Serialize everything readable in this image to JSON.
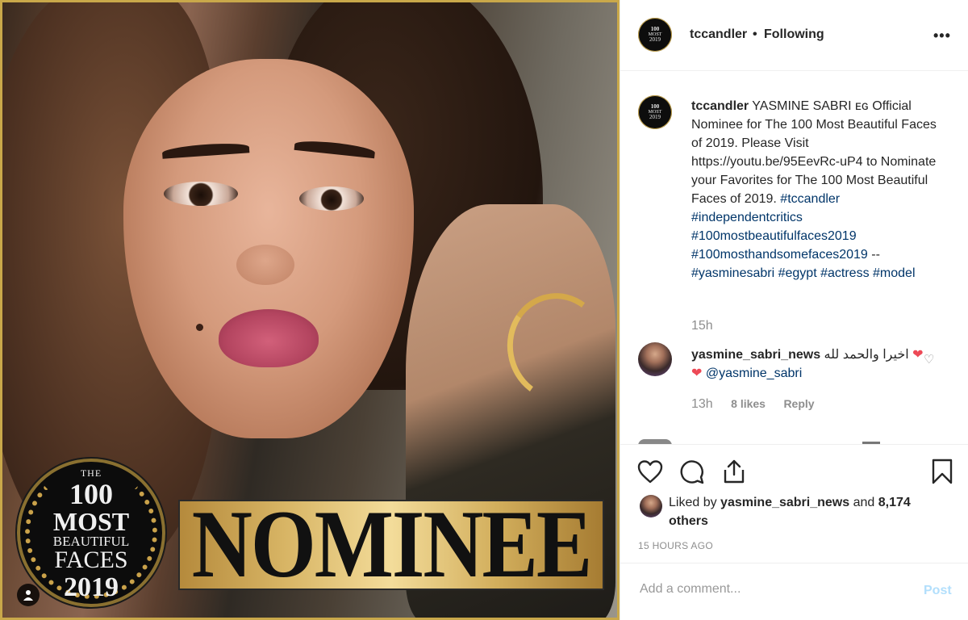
{
  "media": {
    "badge": {
      "line1": "THE",
      "line2": "100",
      "line3": "MOST",
      "line4": "BEAUTIFUL",
      "line5": "FACES",
      "line6": "2019"
    },
    "banner": "NOMINEE",
    "accent": "#c9a84a"
  },
  "header": {
    "username": "tccandler",
    "separator": "•",
    "follow_status": "Following",
    "more": "•••"
  },
  "avatar_badge": {
    "line1": "100",
    "line2": "MOST",
    "line3": "2019"
  },
  "caption": {
    "username": "tccandler",
    "text": "YASMINE SABRI ᴇɢ Official Nominee for The 100 Most Beautiful Faces of 2019. Please Visit https://youtu.be/95EevRc-uP4 to Nominate your Favorites for The 100 Most Beautiful Faces of 2019.",
    "hashtags": [
      "#tccandler",
      "#independentcritics",
      "#100mostbeautifulfaces2019",
      "#100mosthandsomefaces2019"
    ],
    "dashes": "--",
    "hashtags2": [
      "#yasminesabri",
      "#egypt",
      "#actress",
      "#model"
    ],
    "time": "15h"
  },
  "comment": {
    "username": "yasmine_sabri_news",
    "text_ar": "اخيرا والحمد لله",
    "hearts": "❤❤",
    "mention": "@yasmine_sabri",
    "time": "13h",
    "likes": "8 likes",
    "reply": "Reply"
  },
  "actions": {
    "liked_prefix": "Liked by",
    "liked_user": "yasmine_sabri_news",
    "liked_and": "and",
    "liked_count": "8,174 others",
    "time_ago": "15 HOURS AGO"
  },
  "add_comment": {
    "placeholder": "Add a comment...",
    "post_label": "Post",
    "post_color": "#b2dffc"
  },
  "colors": {
    "hashtag": "#003569",
    "muted": "#8e8e8e",
    "heart": "#ed4956"
  }
}
